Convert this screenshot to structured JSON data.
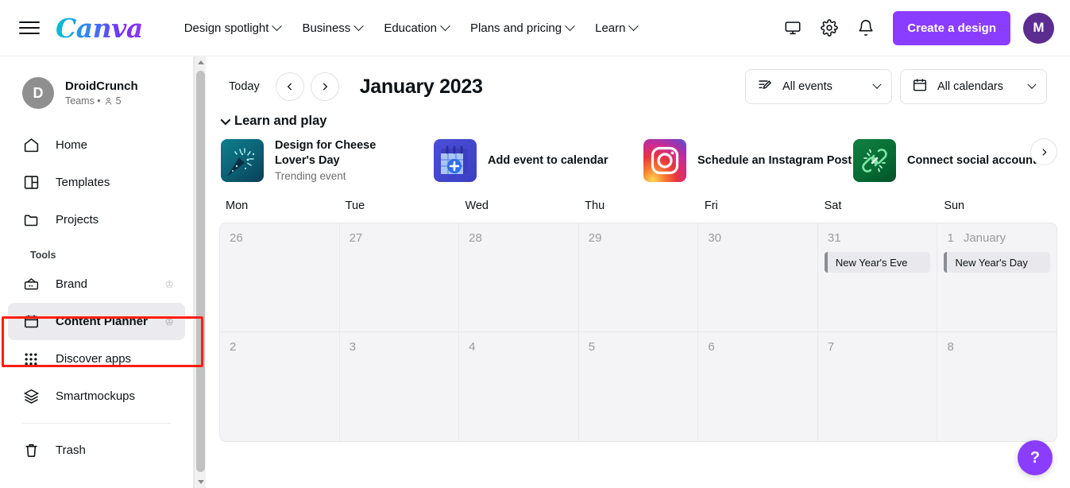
{
  "header": {
    "menu_icon": "hamburger-icon",
    "logo": "Canva",
    "nav": [
      {
        "label": "Design spotlight"
      },
      {
        "label": "Business"
      },
      {
        "label": "Education"
      },
      {
        "label": "Plans and pricing"
      },
      {
        "label": "Learn"
      }
    ],
    "actions": {
      "display_icon": "monitor-icon",
      "settings_icon": "gear-icon",
      "notifications_icon": "bell-icon",
      "create_label": "Create a design",
      "avatar_initial": "M"
    },
    "accent_color": "#8b3dff",
    "avatar_color": "#5c2d91"
  },
  "sidebar": {
    "team": {
      "initial": "D",
      "name": "DroidCrunch",
      "meta": "Teams •",
      "members": "5"
    },
    "items": [
      {
        "label": "Home",
        "icon": "home-icon",
        "pro": false,
        "active": false
      },
      {
        "label": "Templates",
        "icon": "templates-icon",
        "pro": false,
        "active": false
      },
      {
        "label": "Projects",
        "icon": "folder-icon",
        "pro": false,
        "active": false
      }
    ],
    "tools_label": "Tools",
    "tools": [
      {
        "label": "Brand",
        "icon": "brand-icon",
        "pro": true,
        "active": false
      },
      {
        "label": "Content Planner",
        "icon": "calendar-icon",
        "pro": true,
        "active": true
      },
      {
        "label": "Discover apps",
        "icon": "apps-grid-icon",
        "pro": false,
        "active": false
      },
      {
        "label": "Smartmockups",
        "icon": "layers-icon",
        "pro": false,
        "active": false
      }
    ],
    "trash": {
      "label": "Trash",
      "icon": "trash-icon"
    },
    "crown_icon": "crown-icon",
    "highlight_color": "#ff1d12"
  },
  "toolbar": {
    "today_label": "Today",
    "prev_icon": "chevron-left-icon",
    "next_icon": "chevron-right-icon",
    "month_title": "January 2023",
    "filters": [
      {
        "label": "All events",
        "icon": "events-filter-icon"
      },
      {
        "label": "All calendars",
        "icon": "calendar-filter-icon"
      }
    ]
  },
  "learn_and_play": {
    "section_title": "Learn and play",
    "collapse_icon": "chevron-down-icon",
    "next_icon": "chevron-right-icon",
    "cards": [
      {
        "title": "Design for Cheese Lover's Day",
        "subtitle": "Trending event",
        "thumb": "party-popper-thumbnail"
      },
      {
        "title": "Add event to calendar",
        "subtitle": "",
        "thumb": "calendar-plus-icon"
      },
      {
        "title": "Schedule an Instagram Post",
        "subtitle": "",
        "thumb": "instagram-icon"
      },
      {
        "title": "Connect social accounts",
        "subtitle": "",
        "thumb": "link-chain-icon"
      }
    ]
  },
  "calendar": {
    "weekdays": [
      "Mon",
      "Tue",
      "Wed",
      "Thu",
      "Fri",
      "Sat",
      "Sun"
    ],
    "weeks": [
      [
        {
          "day": "26",
          "month": "",
          "muted": true,
          "events": []
        },
        {
          "day": "27",
          "month": "",
          "muted": true,
          "events": []
        },
        {
          "day": "28",
          "month": "",
          "muted": true,
          "events": []
        },
        {
          "day": "29",
          "month": "",
          "muted": true,
          "events": []
        },
        {
          "day": "30",
          "month": "",
          "muted": true,
          "events": []
        },
        {
          "day": "31",
          "month": "",
          "muted": true,
          "events": [
            {
              "label": "New Year's Eve"
            }
          ]
        },
        {
          "day": "1",
          "month": "January",
          "muted": true,
          "events": [
            {
              "label": "New Year's Day"
            }
          ]
        }
      ],
      [
        {
          "day": "2",
          "month": "",
          "muted": true,
          "events": []
        },
        {
          "day": "3",
          "month": "",
          "muted": true,
          "events": []
        },
        {
          "day": "4",
          "month": "",
          "muted": true,
          "events": []
        },
        {
          "day": "5",
          "month": "",
          "muted": true,
          "events": []
        },
        {
          "day": "6",
          "month": "",
          "muted": true,
          "events": []
        },
        {
          "day": "7",
          "month": "",
          "muted": true,
          "events": []
        },
        {
          "day": "8",
          "month": "",
          "muted": true,
          "events": []
        }
      ]
    ]
  },
  "help": {
    "label": "?",
    "icon": "help-icon"
  }
}
